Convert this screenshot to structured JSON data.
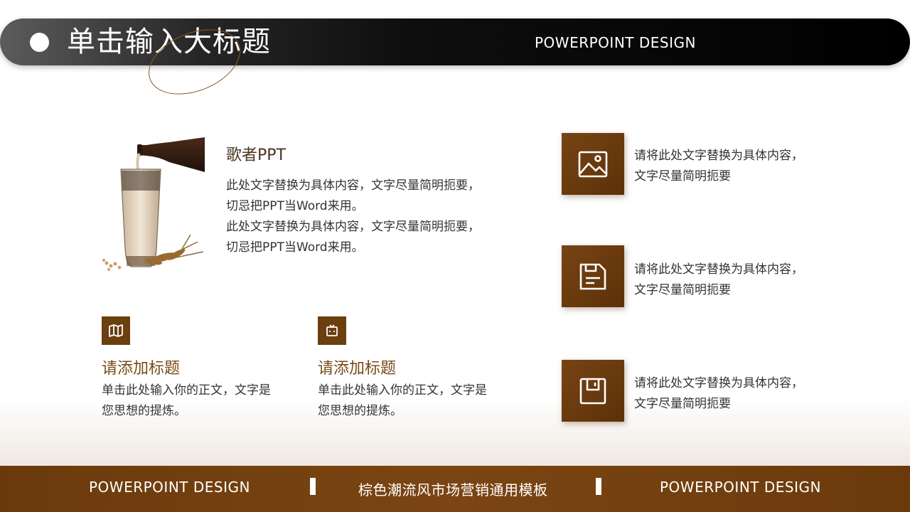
{
  "header": {
    "title": "单击输入大标题",
    "subtitle": "POWERPOINT DESIGN"
  },
  "intro": {
    "title": "歌者PPT",
    "lines": [
      "此处文字替换为具体内容，文字尽量简明扼要，",
      "切忌把PPT当Word来用。",
      "此处文字替换为具体内容，文字尽量简明扼要，",
      "切忌把PPT当Word来用。"
    ]
  },
  "features": [
    {
      "icon": "map-icon",
      "title": "请添加标题",
      "lines": [
        "单击此处输入你的正文，文字是",
        "您思想的提炼。"
      ]
    },
    {
      "icon": "robot-icon",
      "title": "请添加标题",
      "lines": [
        "单击此处输入你的正文，文字是",
        "您思想的提炼。"
      ]
    }
  ],
  "right_items": [
    {
      "icon": "image-icon",
      "lines": [
        "请将此处文字替换为具体内容，",
        "文字尽量简明扼要"
      ]
    },
    {
      "icon": "document-icon",
      "lines": [
        "请将此处文字替换为具体内容，",
        "文字尽量简明扼要"
      ]
    },
    {
      "icon": "save-icon",
      "lines": [
        "请将此处文字替换为具体内容，",
        "文字尽量简明扼要"
      ]
    }
  ],
  "footer": {
    "left": "POWERPOINT DESIGN",
    "center": "棕色潮流风市场营销通用模板",
    "right": "POWERPOINT DESIGN"
  },
  "colors": {
    "brand_brown": "#6b3f0f",
    "header_black": "#000000"
  }
}
